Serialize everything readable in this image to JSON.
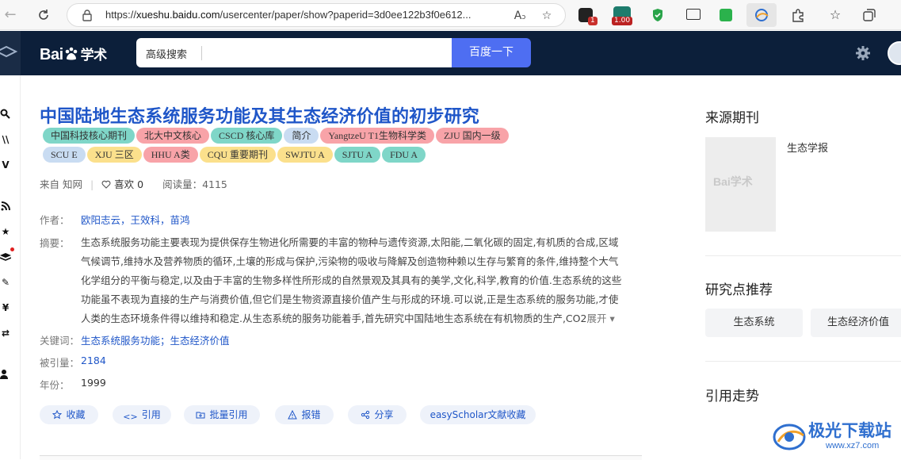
{
  "browser": {
    "url_prefix": "https://",
    "url_host": "xueshu.baidu.com",
    "url_path": "/usercenter/paper/show?paperid=3d0ee122b3f0e612...",
    "ext_badge_1": "1",
    "ext_badge_2": "1.00"
  },
  "header": {
    "logo_text": "Bai",
    "logo_suffix": "学术",
    "adv_search": "高级搜索",
    "search_button": "百度一下"
  },
  "paper": {
    "title": "中国陆地生态系统服务功能及其生态经济价值的初步研究",
    "tags": [
      {
        "label": "中国科技核心期刊",
        "color": "#7fd6c8"
      },
      {
        "label": "北大中文核心",
        "color": "#f8a3a8"
      },
      {
        "label": "CSCD 核心库",
        "color": "#7fd6c8"
      },
      {
        "label": "简介",
        "color": "#c9dcf2"
      },
      {
        "label": "YangtzeU T1生物科学类",
        "color": "#f8a3a8"
      },
      {
        "label": "ZJU 国内一级",
        "color": "#f8a3a8"
      },
      {
        "label": "SCU E",
        "color": "#c9dcf2"
      },
      {
        "label": "XJU 三区",
        "color": "#fbe08c"
      },
      {
        "label": "HHU A类",
        "color": "#f8a3a8"
      },
      {
        "label": "CQU 重要期刊",
        "color": "#fbe08c"
      },
      {
        "label": "SWJTU A",
        "color": "#fbe08c"
      },
      {
        "label": "SJTU A",
        "color": "#7fd6c8"
      },
      {
        "label": "FDU A",
        "color": "#7fd6c8"
      }
    ],
    "source": "来自 知网",
    "likes": "喜欢 0",
    "reads": "阅读量：4115",
    "authors_label": "作者：",
    "authors": "欧阳志云，王效科，苗鸿",
    "abstract_label": "摘要：",
    "abstract_lines": [
      "生态系统服务功能主要表现为提供保存生物进化所需要的丰富的物种与遗传资源,太阳能,二氧化碳的固定,有机质的合成,区域",
      "气候调节,维持水及营养物质的循环,土壤的形成与保护,污染物的吸收与降解及创造物种赖以生存与繁育的条件,维持整个大气",
      "化学组分的平衡与稳定,以及由于丰富的生物多样性所形成的自然景观及其具有的美学,文化,科学,教育的价值.生态系统的这些",
      "功能虽不表现为直接的生产与消费价值,但它们是生物资源直接价值产生与形成的环境.可以说,正是生态系统的服务功能,才使",
      "人类的生态环境条件得以维持和稳定.从生态系统的服务功能着手,首先研究中国陆地生态系统在有机物质的生产,CO2"
    ],
    "abstract_more": "展开",
    "keywords_label": "关键词：",
    "keywords": "生态系统服务功能；生态经济价值",
    "cited_label": "被引量：",
    "cited": "2184",
    "year_label": "年份：",
    "year": "1999"
  },
  "actions": {
    "favorite": "收藏",
    "cite": "引用",
    "batch_cite": "批量引用",
    "report": "报错",
    "share": "分享",
    "easyscholar": "easyScholar文献收藏"
  },
  "sidebar": {
    "source_title": "来源期刊",
    "cover_logo": "Bai学术",
    "journal_name": "生态学报",
    "recommend_title": "研究点推荐",
    "recommend": [
      "生态系统",
      "生态经济价值"
    ],
    "trend_title": "引用走势"
  },
  "watermark": {
    "text": "极光下载站",
    "sub": "www.xz7.com"
  }
}
